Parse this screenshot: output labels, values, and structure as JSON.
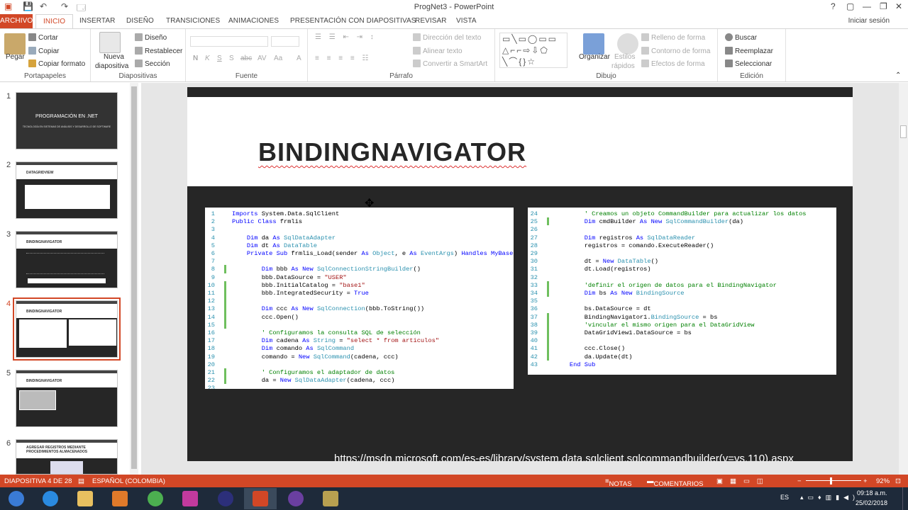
{
  "window": {
    "title": "ProgNet3 - PowerPoint",
    "help": "?",
    "minimize": "—",
    "restore": "❐",
    "close": "✕"
  },
  "quick_access": [
    "💾",
    "↶",
    "↷",
    "🗔"
  ],
  "tabs": {
    "file": "ARCHIVO",
    "items": [
      "INICIO",
      "INSERTAR",
      "DISEÑO",
      "TRANSICIONES",
      "ANIMACIONES",
      "PRESENTACIÓN CON DIAPOSITIVAS",
      "REVISAR",
      "VISTA"
    ],
    "active": "INICIO",
    "sign_in": "Iniciar sesión"
  },
  "ribbon": {
    "clipboard": {
      "label": "Portapapeles",
      "paste": "Pegar",
      "cut": "Cortar",
      "copy": "Copiar",
      "format_painter": "Copiar formato"
    },
    "slides": {
      "label": "Diapositivas",
      "new_slide_1": "Nueva",
      "new_slide_2": "diapositiva",
      "layout": "Diseño",
      "reset": "Restablecer",
      "section": "Sección"
    },
    "font": {
      "label": "Fuente",
      "bold": "N",
      "italic": "K",
      "underline": "S",
      "shadow": "S",
      "strike": "abc",
      "spacing": "AV",
      "case": "Aa",
      "color": "A"
    },
    "paragraph": {
      "label": "Párrafo",
      "text_direction": "Dirección del texto",
      "align_text": "Alinear texto",
      "smartart": "Convertir a SmartArt"
    },
    "drawing": {
      "label": "Dibujo",
      "arrange": "Organizar",
      "quick_styles_1": "Estilos",
      "quick_styles_2": "rápidos",
      "fill": "Relleno de forma",
      "outline": "Contorno de forma",
      "effects": "Efectos de forma"
    },
    "editing": {
      "label": "Edición",
      "find": "Buscar",
      "replace": "Reemplazar",
      "select": "Seleccionar"
    }
  },
  "thumbnails": [
    {
      "num": "1",
      "title": "PROGRAMACIÓN EN .NET",
      "subtitle": "TECNOLOGÍA EN SISTEMAS DE ANÁLISIS Y DESARROLLO DE SOFTWARE"
    },
    {
      "num": "2",
      "title": "DATAGRIDVIEW"
    },
    {
      "num": "3",
      "title": "BINDINGNAVIGATOR"
    },
    {
      "num": "4",
      "title": "BINDINGNAVIGATOR"
    },
    {
      "num": "5",
      "title": "BINDINGNAVIGATOR"
    },
    {
      "num": "6",
      "title": "AGREGAR REGISTROS MEDIANTE PROCEDIMIENTOS ALMACENADOS"
    }
  ],
  "slide": {
    "title": "BINDINGNAVIGATOR",
    "url": "https://msdn.microsoft.com/es-es/library/system.data.sqlclient.sqlcommandbuilder(v=vs.110).aspx",
    "code_left": [
      [
        "1",
        "Imports System.Data.SqlClient"
      ],
      [
        "2",
        "Public Class frmlis"
      ],
      [
        "3",
        ""
      ],
      [
        "4",
        "    Dim da As SqlDataAdapter"
      ],
      [
        "5",
        "    Dim dt As DataTable"
      ],
      [
        "6",
        "    Private Sub frmlis_Load(sender As Object, e As EventArgs) Handles MyBase.Load"
      ],
      [
        "7",
        ""
      ],
      [
        "8",
        "        Dim bbb As New SqlConnectionStringBuilder()"
      ],
      [
        "9",
        "        bbb.DataSource = \"USER\""
      ],
      [
        "10",
        "        bbb.InitialCatalog = \"base1\""
      ],
      [
        "11",
        "        bbb.IntegratedSecurity = True"
      ],
      [
        "12",
        ""
      ],
      [
        "13",
        "        Dim ccc As New SqlConnection(bbb.ToString())"
      ],
      [
        "14",
        "        ccc.Open()"
      ],
      [
        "15",
        ""
      ],
      [
        "16",
        "        ' Configuramos la consulta SQL de selección"
      ],
      [
        "17",
        "        Dim cadena As String = \"select * from articulos\""
      ],
      [
        "18",
        "        Dim comando As SqlCommand"
      ],
      [
        "19",
        "        comando = New SqlCommand(cadena, ccc)"
      ],
      [
        "20",
        ""
      ],
      [
        "21",
        "        ' Configuramos el adaptador de datos"
      ],
      [
        "22",
        "        da = New SqlDataAdapter(cadena, ccc)"
      ],
      [
        "23",
        ""
      ]
    ],
    "code_right": [
      [
        "24",
        "        ' Creamos un objeto CommandBuilder para actualizar los datos"
      ],
      [
        "25",
        "        Dim cmdBuilder As New SqlCommandBuilder(da)"
      ],
      [
        "26",
        ""
      ],
      [
        "27",
        "        Dim registros As SqlDataReader"
      ],
      [
        "28",
        "        registros = comando.ExecuteReader()"
      ],
      [
        "29",
        ""
      ],
      [
        "30",
        "        dt = New DataTable()"
      ],
      [
        "31",
        "        dt.Load(registros)"
      ],
      [
        "32",
        ""
      ],
      [
        "33",
        "        'definir el origen de datos para el BindingNavigator"
      ],
      [
        "34",
        "        Dim bs As New BindingSource"
      ],
      [
        "35",
        ""
      ],
      [
        "36",
        "        bs.DataSource = dt"
      ],
      [
        "37",
        "        BindingNavigator1.BindingSource = bs"
      ],
      [
        "38",
        "        'vincular el mismo origen para el DataGridView"
      ],
      [
        "39",
        "        DataGridView1.DataSource = bs"
      ],
      [
        "40",
        ""
      ],
      [
        "41",
        "        ccc.Close()"
      ],
      [
        "42",
        "        da.Update(dt)"
      ],
      [
        "43",
        "    End Sub"
      ]
    ]
  },
  "status": {
    "slide_info": "DIAPOSITIVA 4 DE 28",
    "language": "ESPAÑOL (COLOMBIA)",
    "notes": "NOTAS",
    "comments": "COMENTARIOS",
    "zoom": "92%"
  },
  "taskbar": {
    "lang": "ES",
    "time": "09:18 a.m.",
    "date": "25/02/2018"
  }
}
